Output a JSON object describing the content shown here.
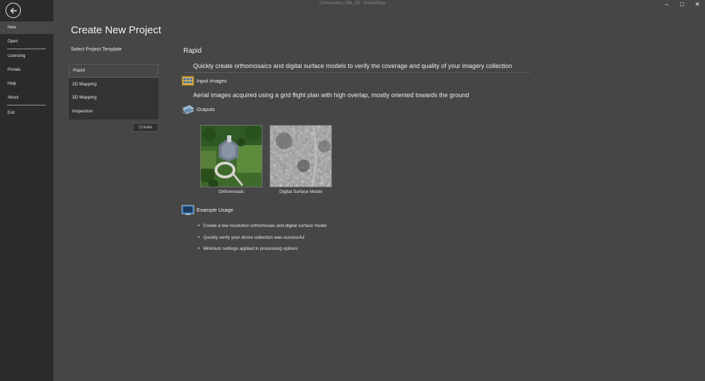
{
  "window": {
    "title": "Construction_Site_2D - Drone2Map",
    "minimize": "–",
    "maximize": "□",
    "close": "✕"
  },
  "sidebar": {
    "items": [
      {
        "label": "New"
      },
      {
        "label": "Open"
      },
      {
        "label": "Licensing"
      },
      {
        "label": "Portals"
      },
      {
        "label": "Help"
      },
      {
        "label": "About"
      },
      {
        "label": "Exit"
      }
    ]
  },
  "main": {
    "title": "Create New Project",
    "template_caption": "Select Project Template",
    "templates": [
      {
        "label": "Rapid"
      },
      {
        "label": "2D Mapping"
      },
      {
        "label": "3D Mapping"
      },
      {
        "label": "Inspection"
      }
    ],
    "create_label": "Create"
  },
  "detail": {
    "title": "Rapid",
    "description": "Quickly create orthomosaics and digital surface models to verify the coverage and quality of your imagery collection",
    "input_heading": "Input Images",
    "input_text": "Aerial images acquired using a grid flight plan with high overlap, mostly oriented towards the ground",
    "outputs_heading": "Outputs",
    "outputs": [
      {
        "label": "Orthomosaic"
      },
      {
        "label": "Digital Surface Model"
      }
    ],
    "usage_heading": "Example Usage",
    "usage": [
      "Create a low resolution orthomosaic and digital surface model",
      "Quickly verify your drone collection was successful",
      "Minimum settings applied in processing options"
    ]
  },
  "colors": {
    "background": "#464646",
    "sidebar": "#2b2b2b",
    "list": "#333333"
  }
}
